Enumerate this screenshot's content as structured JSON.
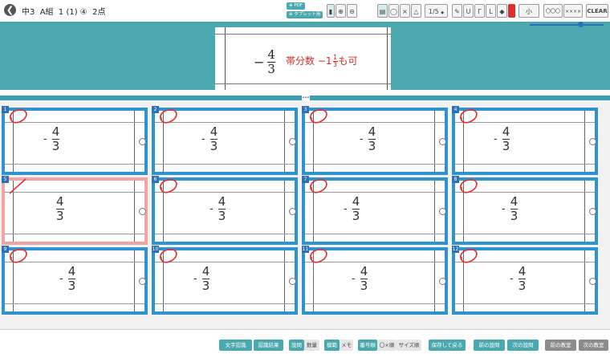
{
  "header": {
    "title": "中3  A組  1 (1) ④  2点",
    "pdf_label": "PDF",
    "tablet_label": "タブレット用",
    "page_indicator": "1/5",
    "page_caret": "◆",
    "tool_glyphs": {
      "zoom_in": "⊕",
      "zoom_out": "⊖",
      "pencil": "✎",
      "underline": "U",
      "corner1": "Γ",
      "corner2": "L",
      "eraser": "◆",
      "size": "小",
      "mark1": "〇〇〇",
      "mark2": "××××",
      "circle": "◯",
      "cross": "×",
      "triangle": "△"
    },
    "clear_label": "CLEAR",
    "color_accent": "#e02d2d"
  },
  "reference": {
    "sign": "−",
    "num": "4",
    "den": "3",
    "note_prefix": "帯分数 −1",
    "note_num": "1",
    "note_den": "3",
    "note_suffix": "も可"
  },
  "divider_label": "•••",
  "answers": [
    {
      "no": "1",
      "sign": "-",
      "num": "4",
      "den": "3",
      "marked": "circle",
      "state": "blue"
    },
    {
      "no": "2",
      "sign": "-",
      "num": "4",
      "den": "3",
      "marked": "circle",
      "state": "blue"
    },
    {
      "no": "3",
      "sign": "-",
      "num": "4",
      "den": "3",
      "marked": "circle",
      "state": "blue"
    },
    {
      "no": "4",
      "sign": "-",
      "num": "4",
      "den": "3",
      "marked": "circle",
      "state": "blue"
    },
    {
      "no": "5",
      "sign": "",
      "num": "4",
      "den": "3",
      "marked": "slash",
      "state": "pink"
    },
    {
      "no": "6",
      "sign": "-",
      "num": "4",
      "den": "3",
      "marked": "circle",
      "state": "blue"
    },
    {
      "no": "7",
      "sign": "-",
      "num": "4",
      "den": "3",
      "marked": "circle",
      "state": "blue"
    },
    {
      "no": "8",
      "sign": "-",
      "num": "4",
      "den": "3",
      "marked": "circle",
      "state": "blue"
    },
    {
      "no": "9",
      "sign": "-",
      "num": "4",
      "den": "3",
      "marked": "circle",
      "state": "blue"
    },
    {
      "no": "10",
      "sign": "-",
      "num": "4",
      "den": "3",
      "marked": "circle",
      "state": "blue"
    },
    {
      "no": "11",
      "sign": "-",
      "num": "4",
      "den": "3",
      "marked": "circle",
      "state": "blue"
    },
    {
      "no": "12",
      "sign": "-",
      "num": "4",
      "den": "3",
      "marked": "circle",
      "state": "blue"
    }
  ],
  "footer": {
    "btn_ocr": "文字認識",
    "btn_ocr_result": "認識結果",
    "btn_problem": "設問",
    "btn_score": "数量",
    "btn_model": "模範",
    "btn_memo": "メモ",
    "btn_number_order": "番号順",
    "btn_ox_order": "〇×順",
    "btn_size_order": "サイズ順",
    "btn_save_back": "保存して戻る",
    "btn_prev_q": "前の設問",
    "btn_next_q": "次の設問",
    "btn_prev_class": "前の教室",
    "btn_next_class": "次の教室"
  }
}
